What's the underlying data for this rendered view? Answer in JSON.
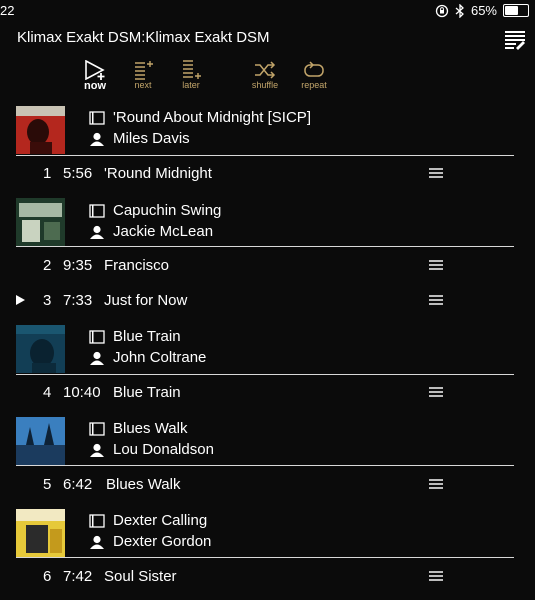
{
  "status": {
    "time": "22",
    "battery": "65%",
    "battery_level": 0.65
  },
  "header": {
    "title": "Klimax Exakt DSM:Klimax Exakt DSM"
  },
  "toolbar": {
    "now_label": "now",
    "next_label": "next",
    "later_label": "later",
    "shuffle_label": "shuffle",
    "repeat_label": "repeat",
    "accent": "#c2a56a"
  },
  "albums": [
    {
      "title": "'Round About Midnight [SICP]",
      "artist": "Miles Davis"
    },
    {
      "title": "Capuchin Swing",
      "artist": "Jackie McLean"
    },
    {
      "title": "Blue Train",
      "artist": "John Coltrane"
    },
    {
      "title": "Blues Walk",
      "artist": "Lou Donaldson"
    },
    {
      "title": "Dexter Calling",
      "artist": "Dexter Gordon"
    }
  ],
  "tracks": [
    {
      "num": "1",
      "duration": "5:56",
      "name": "'Round Midnight",
      "playing": false
    },
    {
      "num": "2",
      "duration": "9:35",
      "name": "Francisco",
      "playing": false
    },
    {
      "num": "3",
      "duration": "7:33",
      "name": "Just for Now",
      "playing": true
    },
    {
      "num": "4",
      "duration": "10:40",
      "name": "Blue Train",
      "playing": false
    },
    {
      "num": "5",
      "duration": "6:42",
      "name": "Blues Walk",
      "playing": false
    },
    {
      "num": "6",
      "duration": "7:42",
      "name": "Soul Sister",
      "playing": false
    }
  ]
}
